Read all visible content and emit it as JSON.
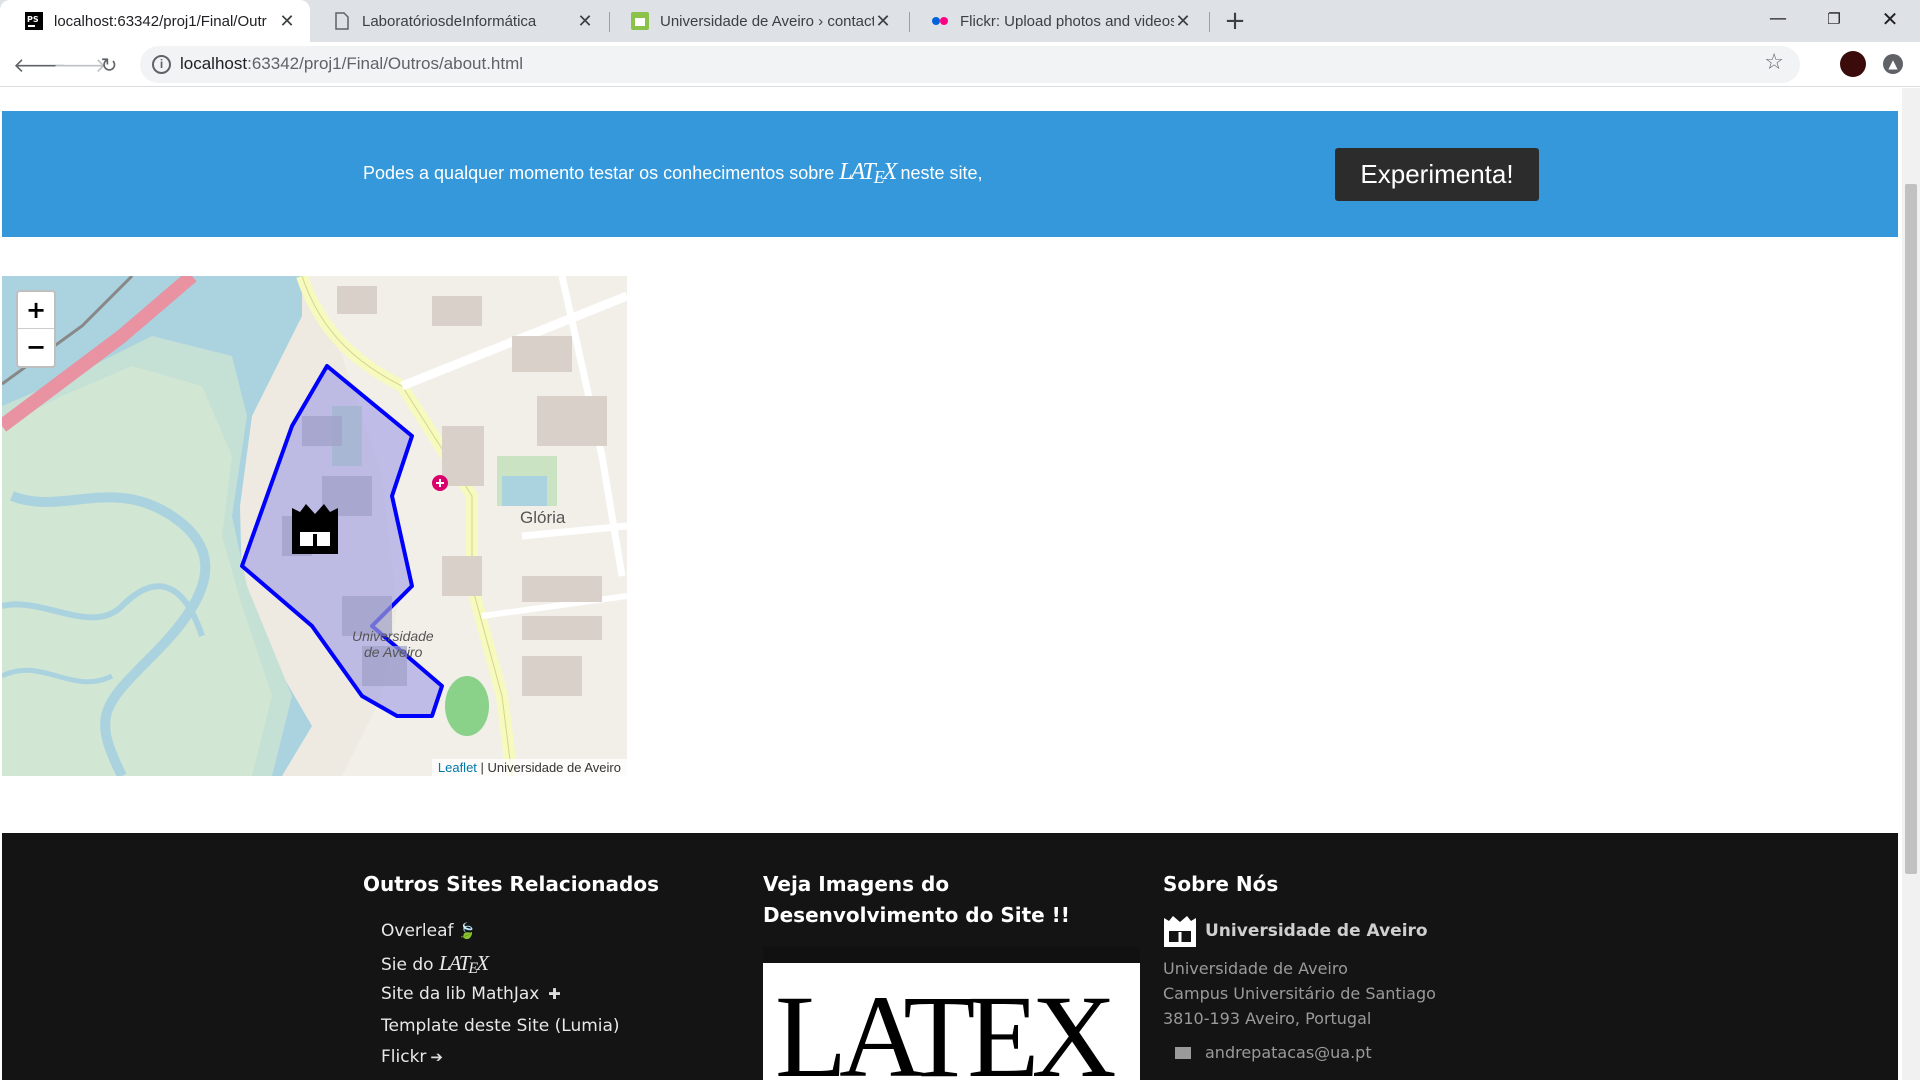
{
  "browser": {
    "tabs": [
      {
        "title": "localhost:63342/proj1/Final/Outr",
        "favicon": "pycharm-icon",
        "active": true
      },
      {
        "title": "LaboratóriosdeInformática",
        "favicon": "page-icon",
        "active": false
      },
      {
        "title": "Universidade de Aveiro › contact",
        "favicon": "ua-icon",
        "active": false
      },
      {
        "title": "Flickr: Upload photos and videos",
        "favicon": "flickr-icon",
        "active": false
      }
    ],
    "url_host": "localhost",
    "url_rest": ":63342/proj1/Final/Outros/about.html"
  },
  "cta": {
    "text_before": "Podes a qualquer momento testar os conhecimentos sobre",
    "latex": {
      "la": "LA",
      "t": "T",
      "e": "E",
      "x": "X"
    },
    "text_after": "neste site,",
    "button_label": "Experimenta!"
  },
  "map": {
    "zoom_in": "+",
    "zoom_out": "−",
    "attribution_link": "Leaflet",
    "attribution_text": "| Universidade de Aveiro",
    "labels": {
      "gloria": "Glória",
      "uni_line1": "Universidade",
      "uni_line2": "de Aveiro"
    },
    "polygon_color": "#0000ff",
    "polygon_fill": "#8080e6"
  },
  "footer": {
    "col1": {
      "title": "Outros Sites Relacionados",
      "links": [
        {
          "label": "Overleaf",
          "icon": "leaf-icon"
        },
        {
          "label": "Sie do",
          "icon": "latex-logo"
        },
        {
          "label": "Site da lib MathJax",
          "icon": "plus-icon"
        },
        {
          "label": "Template deste Site (Lumia)",
          "icon": ""
        },
        {
          "label": "Flickr",
          "icon": "arrow-right-icon"
        }
      ]
    },
    "col2": {
      "title": "Veja Imagens do Desenvolvimento do Site !!",
      "image_text": "LATEX"
    },
    "col3": {
      "title": "Sobre Nós",
      "org": "Universidade de Aveiro",
      "address": [
        "Universidade de Aveiro",
        "Campus Universitário de Santiago",
        "3810-193 Aveiro, Portugal"
      ],
      "email": "andrepatacas@ua.pt"
    }
  },
  "colors": {
    "cta_bg": "#3498db",
    "footer_bg": "#141414",
    "button_bg": "#2c2c2c"
  }
}
